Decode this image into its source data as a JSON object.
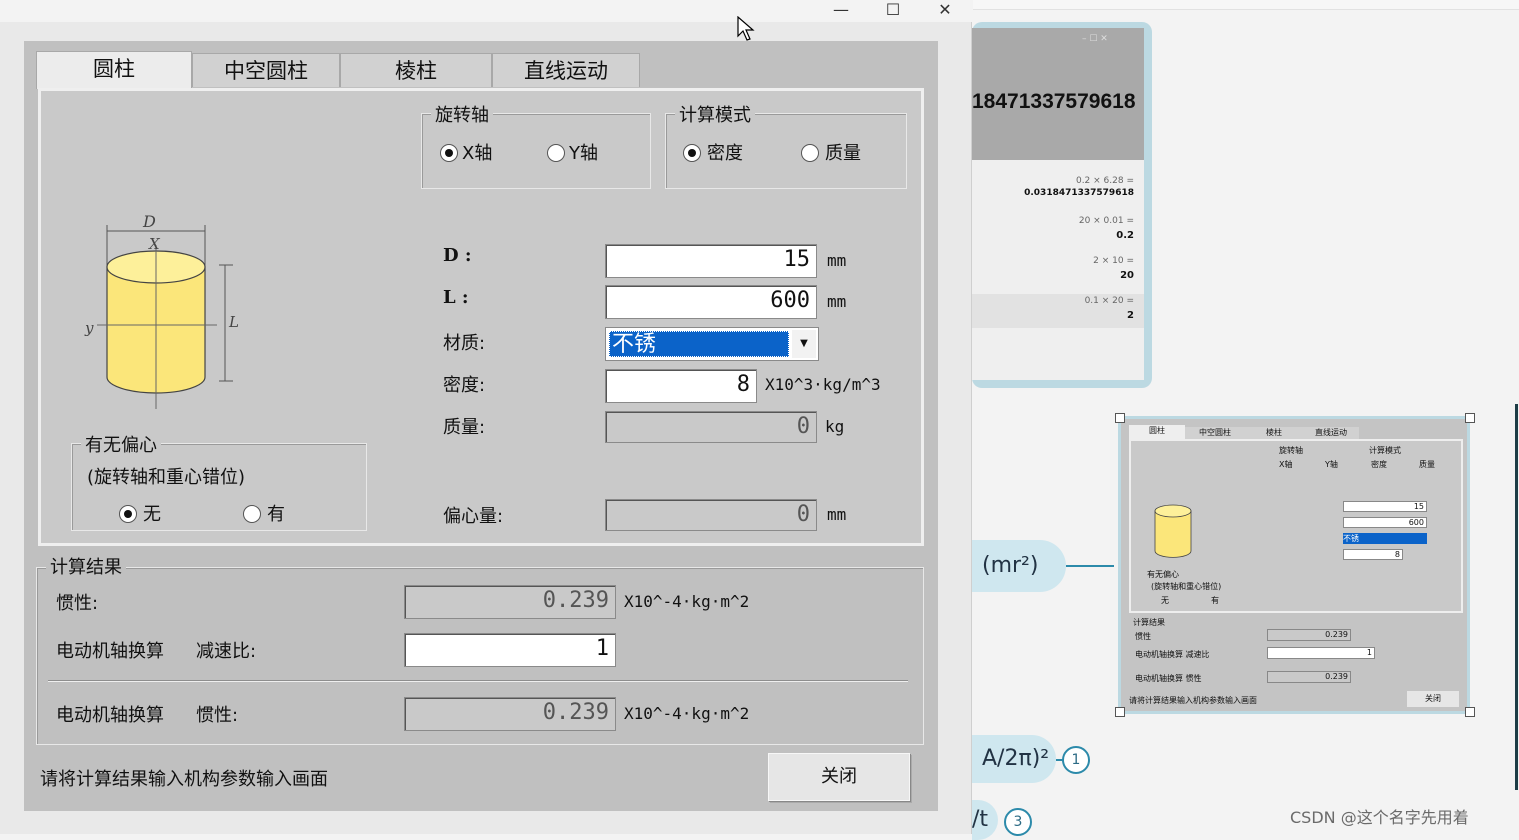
{
  "window": {
    "minimize_glyph": "—",
    "maximize_glyph": "☐",
    "close_glyph": "✕"
  },
  "tabs": [
    {
      "label": "圆柱",
      "active": true
    },
    {
      "label": "中空圆柱",
      "active": false
    },
    {
      "label": "棱柱",
      "active": false
    },
    {
      "label": "直线运动",
      "active": false
    }
  ],
  "rotation_axis": {
    "title": "旋转轴",
    "options": [
      {
        "label": "X轴",
        "checked": true
      },
      {
        "label": "Y轴",
        "checked": false
      }
    ]
  },
  "calc_mode": {
    "title": "计算模式",
    "options": [
      {
        "label": "密度",
        "checked": true
      },
      {
        "label": "质量",
        "checked": false
      }
    ]
  },
  "diagram": {
    "d_label": "D",
    "x_label": "X",
    "y_label": "y",
    "l_label": "L"
  },
  "eccentric": {
    "title": "有无偏心",
    "subtitle": "(旋转轴和重心错位)",
    "options": [
      {
        "label": "无",
        "checked": true
      },
      {
        "label": "有",
        "checked": false
      }
    ]
  },
  "params": {
    "d": {
      "label": "D :",
      "value": "15",
      "unit": "mm"
    },
    "l": {
      "label": "L :",
      "value": "600",
      "unit": "mm"
    },
    "material": {
      "label": "材质:",
      "value": "不锈"
    },
    "density": {
      "label": "密度:",
      "value": "8",
      "unit": "X10^3·kg/m^3"
    },
    "mass": {
      "label": "质量:",
      "value": "0",
      "unit": "kg"
    },
    "eccentricity": {
      "label": "偏心量:",
      "value": "0",
      "unit": "mm"
    }
  },
  "results": {
    "title": "计算结果",
    "inertia": {
      "label": "惯性:",
      "value": "0.239",
      "unit": "X10^-4·kg·m^2"
    },
    "motor_conv": {
      "label": "电动机轴换算",
      "ratio_label": "减速比:",
      "ratio_value": "1"
    },
    "motor_inertia": {
      "label": "电动机轴换算",
      "sub_label": "惯性:",
      "value": "0.239",
      "unit": "X10^-4·kg·m^2"
    }
  },
  "footer": {
    "hint": "请将计算结果输入机构参数输入画面",
    "close_label": "关闭"
  },
  "background": {
    "calc_display": "18471337579618",
    "calc_history": [
      {
        "expr": "0.2 × 6.28 =",
        "value": "0.0318471337579618"
      },
      {
        "expr": "20 × 0.01 =",
        "value": "0.2"
      },
      {
        "expr": "2 × 10 =",
        "value": "20"
      },
      {
        "expr": "0.1 × 20 =",
        "value": "2"
      }
    ],
    "mr2": "(mr²)",
    "formula1": "A/2π)²",
    "formula1_badge": "1",
    "formula2": "/t",
    "formula2_badge": "3",
    "watermark": "CSDN @这个名字先用着"
  },
  "thumbnail": {
    "tabs": [
      "圆柱",
      "中空圆柱",
      "棱柱",
      "直线运动"
    ],
    "axis_title": "旋转轴",
    "mode_title": "计算模式",
    "x_axis": "X轴",
    "y_axis": "Y轴",
    "density": "密度",
    "mass": "质量",
    "d": "15",
    "l": "600",
    "material": "不锈",
    "dens": "8",
    "ecc_title": "有无偏心",
    "ecc_sub": "(旋转轴和重心错位)",
    "ecc_no": "无",
    "ecc_yes": "有",
    "result_title": "计算结果",
    "inertia_label": "惯性",
    "inertia": "0.239",
    "ratio_label": "电动机轴换算  减速比",
    "ratio": "1",
    "motor_label": "电动机轴换算  惯性",
    "motor": "0.239",
    "hint": "请将计算结果输入机构参数输入画面",
    "close": "关闭"
  }
}
